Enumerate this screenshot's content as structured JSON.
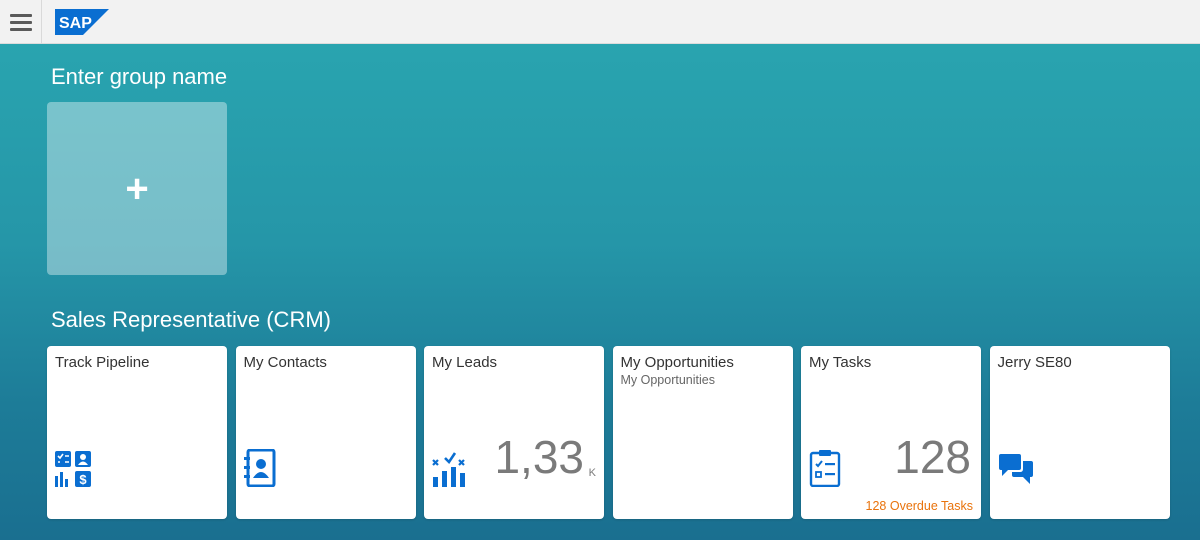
{
  "shell": {
    "menu_icon": "hamburger-icon",
    "logo_text": "SAP",
    "brand_color": "#0a6ed1"
  },
  "groups": [
    {
      "title": "Enter group name",
      "add_tile_icon": "+"
    },
    {
      "title": "Sales Representative (CRM)",
      "tiles": [
        {
          "title": "Track Pipeline",
          "icon": "pipeline-icon"
        },
        {
          "title": "My Contacts",
          "icon": "address-book-icon"
        },
        {
          "title": "My Leads",
          "icon": "leads-icon",
          "number": "1,33",
          "unit": "K"
        },
        {
          "title": "My Opportunities",
          "subtitle": "My Opportunities"
        },
        {
          "title": "My Tasks",
          "icon": "task-clipboard-icon",
          "number": "128",
          "info": "128 Overdue Tasks",
          "info_color": "#e9730c"
        },
        {
          "title": "Jerry SE80",
          "icon": "chat-bubbles-icon"
        }
      ]
    }
  ]
}
